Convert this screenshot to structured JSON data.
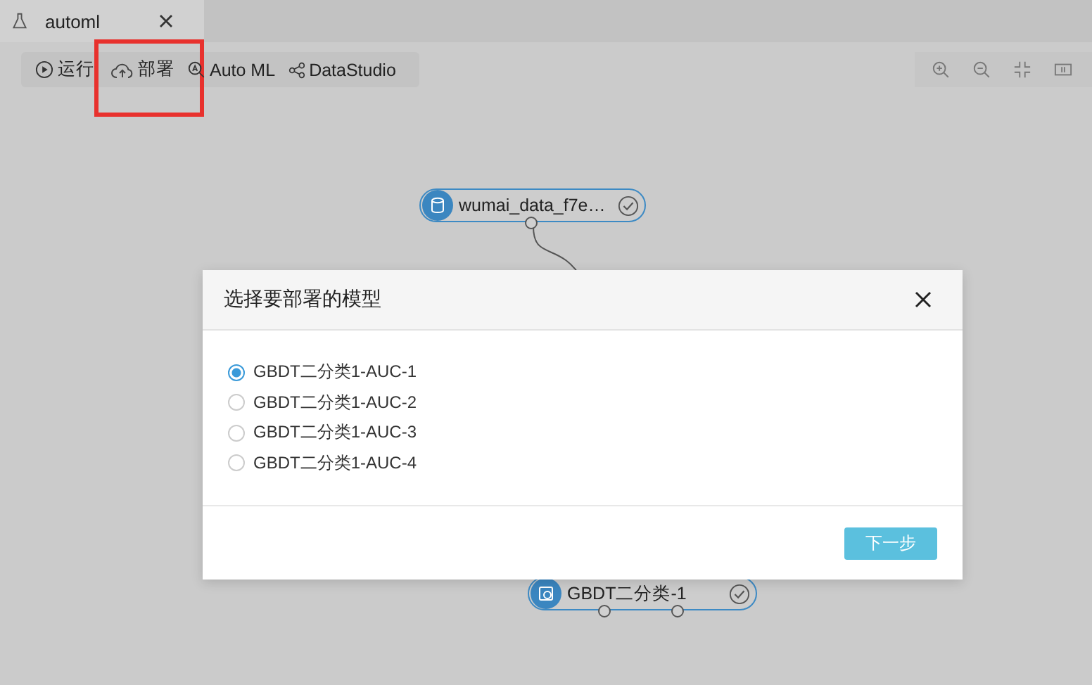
{
  "tab": {
    "title": "automl",
    "selected": true
  },
  "toolbar": [
    {
      "kind": "run",
      "label": "运行",
      "highlighted": false
    },
    {
      "kind": "deploy",
      "label": "部署",
      "highlighted": true
    },
    {
      "kind": "automl",
      "label": "Auto ML",
      "highlighted": false
    },
    {
      "kind": "datastudio",
      "label": "DataStudio",
      "highlighted": false
    }
  ],
  "nodes": [
    {
      "kind": "data",
      "label": "wumai_data_f7e…"
    },
    {
      "kind": "model",
      "label": "GBDT二分类-1"
    }
  ],
  "dialog": {
    "title": "选择要部署的模型",
    "options": [
      {
        "label": "GBDT二分类1-AUC-1",
        "selected": true
      },
      {
        "label": "GBDT二分类1-AUC-2",
        "selected": false
      },
      {
        "label": "GBDT二分类1-AUC-3",
        "selected": false
      },
      {
        "label": "GBDT二分类1-AUC-4",
        "selected": false
      }
    ],
    "primary_button": "下一步"
  }
}
